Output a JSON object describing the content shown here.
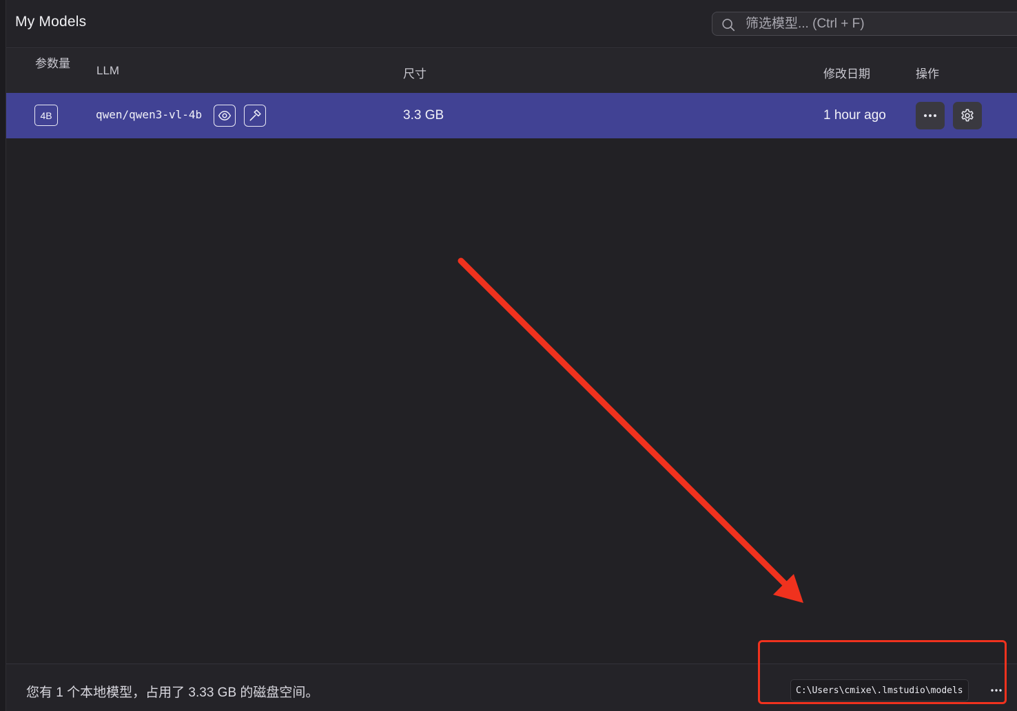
{
  "header": {
    "title": "My Models",
    "search_placeholder": "筛选模型... (Ctrl + F)"
  },
  "columns": {
    "params": "参数量",
    "llm": "LLM",
    "size": "尺寸",
    "modified": "修改日期",
    "actions": "操作"
  },
  "models": [
    {
      "params": "4B",
      "name": "qwen/qwen3-vl-4b",
      "capabilities": [
        "eye-icon",
        "hammer-icon"
      ],
      "size": "3.3 GB",
      "modified": "1 hour ago"
    }
  ],
  "footer": {
    "summary": "您有 1 个本地模型，占用了 3.33 GB 的磁盘空间。",
    "models_path": "C:\\Users\\cmixe\\.lmstudio\\models"
  },
  "colors": {
    "background": "#222125",
    "selected_row": "#414294",
    "annotation": "#f0321e"
  }
}
